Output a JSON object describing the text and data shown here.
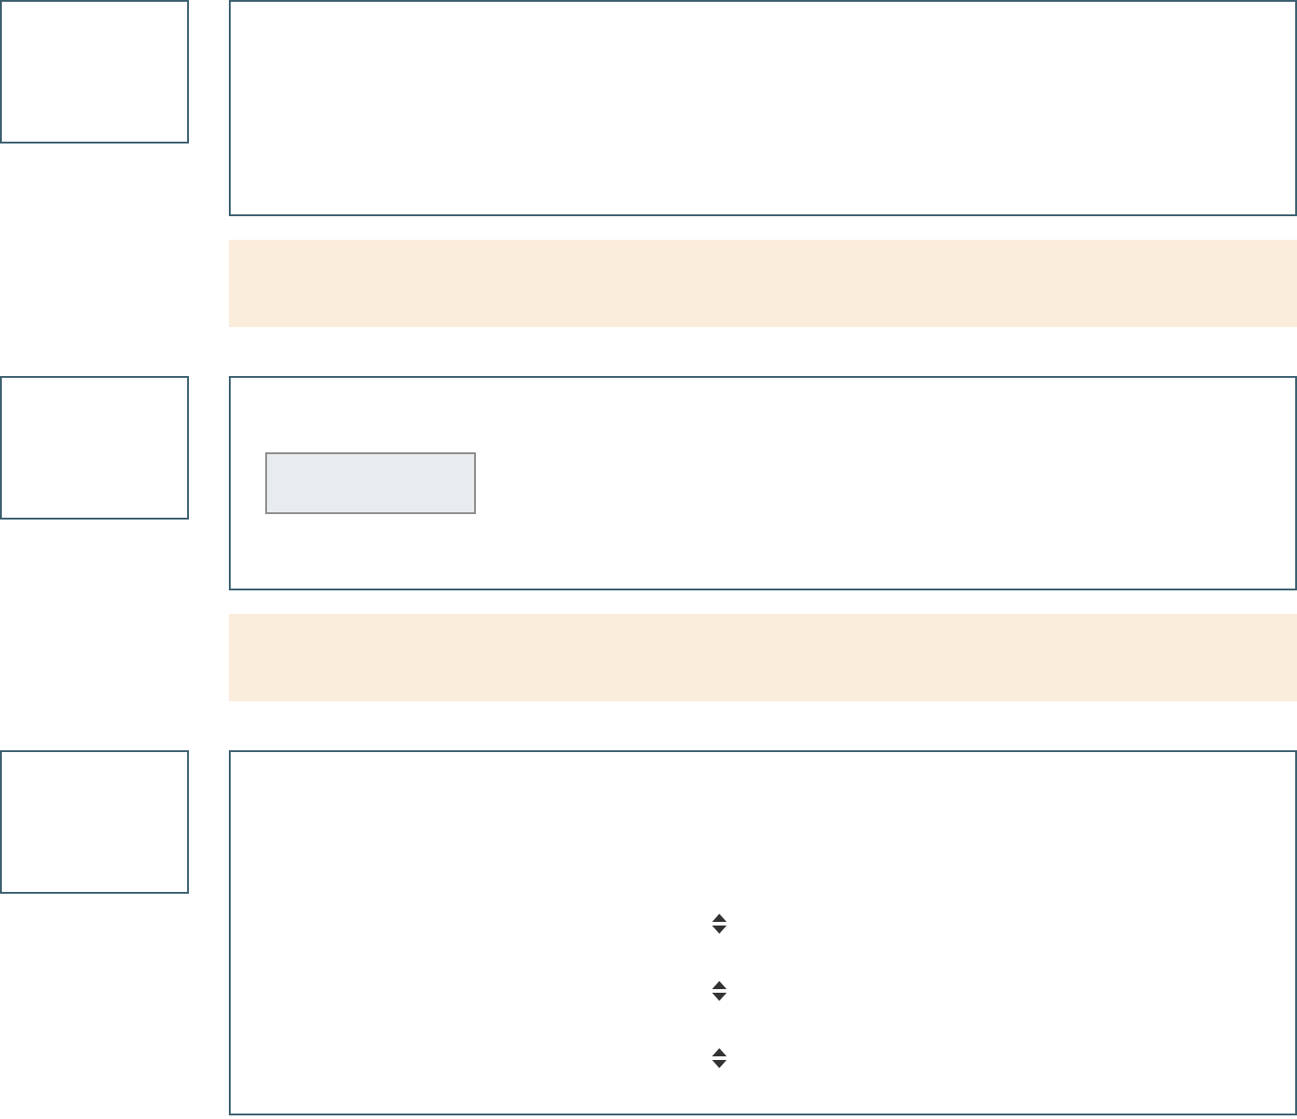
{
  "blocks": [
    {
      "kind": "panel",
      "panel": {
        "kind": "blank"
      }
    },
    {
      "kind": "notice"
    },
    {
      "kind": "panel",
      "panel": {
        "kind": "field",
        "disabled": true
      }
    },
    {
      "kind": "notice"
    },
    {
      "kind": "panel",
      "panel": {
        "kind": "sort_rows",
        "rows": [
          {
            "sortable": true
          },
          {
            "sortable": true
          },
          {
            "sortable": true
          }
        ]
      }
    }
  ]
}
